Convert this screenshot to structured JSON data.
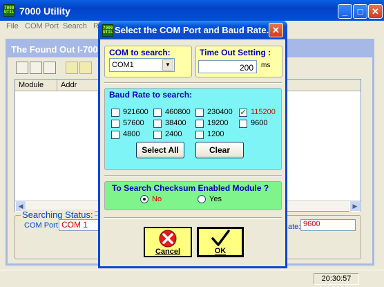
{
  "main_window": {
    "icon_text": "7000 UTIL",
    "title": "7000 Utility",
    "menu": [
      "File",
      "COM Port",
      "Search",
      "R"
    ]
  },
  "child_window": {
    "title": "The Found Out I-7000",
    "columns": [
      "Module",
      "Addr"
    ],
    "status_group_label": "Searching Status:",
    "com_port_label": "COM Port:",
    "com_port_value": "COM 1",
    "rate_label": "ate:",
    "rate_value": "9600"
  },
  "status_bar": {
    "clock": "20:30:57"
  },
  "dialog": {
    "icon_text": "7000 UTIL",
    "title": "Select the COM Port and Baud Rate...",
    "com_group_label": "COM to search:",
    "com_selected": "COM1",
    "timeout_group_label": "Time Out Setting :",
    "timeout_value": "200",
    "timeout_unit": "ms",
    "baud_group_label": "Baud Rate to search:",
    "baud_rates": [
      {
        "label": "921600",
        "checked": false
      },
      {
        "label": "460800",
        "checked": false
      },
      {
        "label": "230400",
        "checked": false
      },
      {
        "label": "115200",
        "checked": true
      },
      {
        "label": "57600",
        "checked": false
      },
      {
        "label": "38400",
        "checked": false
      },
      {
        "label": "19200",
        "checked": false
      },
      {
        "label": "9600",
        "checked": false
      },
      {
        "label": "4800",
        "checked": false
      },
      {
        "label": "2400",
        "checked": false
      },
      {
        "label": "1200",
        "checked": false
      }
    ],
    "select_all_label": "Select  All",
    "clear_label": "Clear",
    "checksum_group_label": "To Search Checksum Enabled Module ?",
    "checksum_no": "No",
    "checksum_yes": "Yes",
    "checksum_selected": "No",
    "cancel_label": "Cancel",
    "ok_label": "OK"
  },
  "colors": {
    "title_blue": "#0a4bcc",
    "yellow_panel": "#ffffa8",
    "cyan_panel": "#7ff4f6",
    "green_panel": "#7ff48a",
    "red_value": "#e00000"
  }
}
